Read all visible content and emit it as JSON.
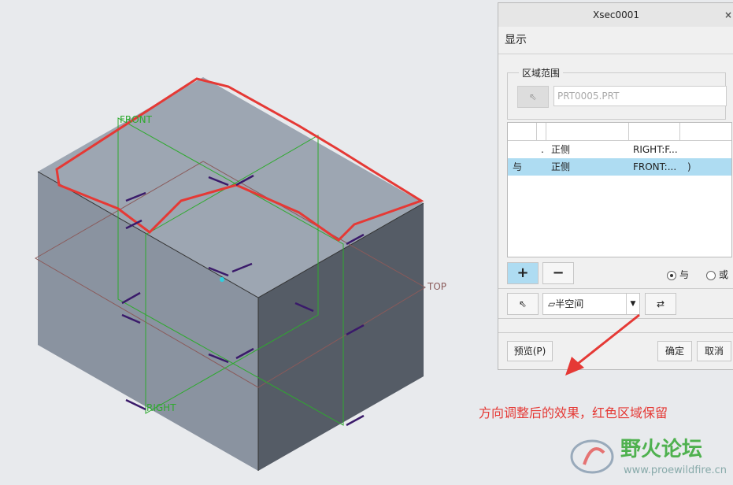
{
  "viewport": {
    "labels": {
      "front": "FRONT",
      "right": "RIGHT",
      "top": "TOP"
    }
  },
  "dialog": {
    "title": "Xsec0001",
    "close": "×",
    "section": "显示",
    "group_label": "区域范围",
    "ref_value": "PRT0005.PRT",
    "rows": [
      {
        "op": ".",
        "side": "正侧",
        "ref": "RIGHT:F...",
        "extra": ""
      },
      {
        "op": "与",
        "side": "正侧",
        "ref": "FRONT:...",
        "extra": ")"
      }
    ],
    "add": "+",
    "remove": "−",
    "radio_and": "与",
    "radio_or": "或",
    "radio_selected": "and",
    "type_value": "半空间",
    "preview": "预览(P)",
    "ok": "确定",
    "cancel": "取消"
  },
  "annotation": "方向调整后的效果，红色区域保留",
  "watermark": {
    "name": "野火论坛",
    "url": "www.proewildfire.cn"
  }
}
